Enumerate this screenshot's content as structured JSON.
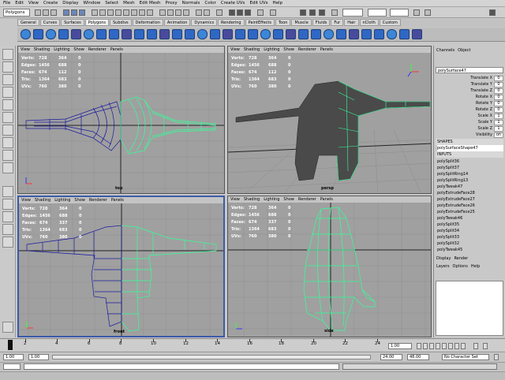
{
  "menubar": [
    "File",
    "Edit",
    "View",
    "Create",
    "Display",
    "Window",
    "Select",
    "Mesh",
    "Edit Mesh",
    "Proxy",
    "Normals",
    "Color",
    "Create UVs",
    "Edit UVs",
    "Help"
  ],
  "statusline": {
    "mode": "Polygons"
  },
  "shelf_tabs": [
    "General",
    "Curves",
    "Surfaces",
    "Polygons",
    "Subdivs",
    "Deformation",
    "Animation",
    "Dynamics",
    "Rendering",
    "PaintEffects",
    "Toon",
    "Muscle",
    "Fluids",
    "Fur",
    "Hair",
    "nCloth",
    "Custom"
  ],
  "hud_labels": [
    "Verts:",
    "Edges:",
    "Faces:",
    "Tris:",
    "UVs:"
  ],
  "viewports": [
    {
      "menu": [
        "View",
        "Shading",
        "Lighting",
        "Show",
        "Renderer",
        "Panels"
      ],
      "hud": [
        [
          "728",
          "364",
          "0"
        ],
        [
          "1456",
          "688",
          "0"
        ],
        [
          "674",
          "112",
          "0"
        ],
        [
          "1364",
          "683",
          "0"
        ],
        [
          "760",
          "380",
          "0"
        ]
      ],
      "camera": "top"
    },
    {
      "menu": [
        "View",
        "Shading",
        "Lighting",
        "Show",
        "Renderer",
        "Panels"
      ],
      "hud": [
        [
          "728",
          "364",
          "0"
        ],
        [
          "1456",
          "688",
          "0"
        ],
        [
          "674",
          "112",
          "0"
        ],
        [
          "1364",
          "683",
          "0"
        ],
        [
          "760",
          "380",
          "0"
        ]
      ],
      "camera": "persp"
    },
    {
      "menu": [
        "View",
        "Shading",
        "Lighting",
        "Show",
        "Renderer",
        "Panels"
      ],
      "hud": [
        [
          "728",
          "364",
          "0"
        ],
        [
          "1456",
          "688",
          "0"
        ],
        [
          "674",
          "337",
          "0"
        ],
        [
          "1364",
          "683",
          "0"
        ],
        [
          "760",
          "380",
          "0"
        ]
      ],
      "camera": "front"
    },
    {
      "menu": [
        "View",
        "Shading",
        "Lighting",
        "Show",
        "Renderer",
        "Panels"
      ],
      "hud": [
        [
          "728",
          "364",
          "0"
        ],
        [
          "1456",
          "688",
          "0"
        ],
        [
          "674",
          "337",
          "0"
        ],
        [
          "1364",
          "683",
          "0"
        ],
        [
          "760",
          "380",
          "0"
        ]
      ],
      "camera": "side"
    }
  ],
  "channel_box": {
    "tabs": [
      "Channels",
      "Object"
    ],
    "object": "polySurface47",
    "attributes": [
      {
        "label": "Translate X",
        "value": "0"
      },
      {
        "label": "Translate Y",
        "value": "0"
      },
      {
        "label": "Translate Z",
        "value": "0"
      },
      {
        "label": "Rotate X",
        "value": "0"
      },
      {
        "label": "Rotate Y",
        "value": "0"
      },
      {
        "label": "Rotate Z",
        "value": "0"
      },
      {
        "label": "Scale X",
        "value": "1"
      },
      {
        "label": "Scale Y",
        "value": "1"
      },
      {
        "label": "Scale Z",
        "value": "1"
      },
      {
        "label": "Visibility",
        "value": "on"
      }
    ],
    "shapes_title": "SHAPES",
    "shape": "polySurfaceShape47",
    "inputs_title": "INPUTS",
    "inputs": [
      "polySplit36",
      "polySplit37",
      "polySplitRing14",
      "polySplitRing13",
      "polyTweak47",
      "polyExtrudeFace28",
      "polyExtrudeFace27",
      "polyExtrudeFace26",
      "polyExtrudeFace25",
      "polyTweak46",
      "polySplit35",
      "polySplit34",
      "polySplit33",
      "polySplit32",
      "polyTweak45"
    ],
    "layers_tabs": [
      "Display",
      "Render"
    ],
    "layers_menu": [
      "Layers",
      "Options",
      "Help"
    ]
  },
  "timeline": {
    "ticks": [
      "2",
      "4",
      "6",
      "8",
      "10",
      "12",
      "14",
      "16",
      "18",
      "20",
      "22",
      "24"
    ],
    "current_frame": "1.00",
    "start": "1.00",
    "end": "24.00",
    "anim_end": "48.00",
    "start2": "1.00",
    "character": "No Character Set"
  }
}
